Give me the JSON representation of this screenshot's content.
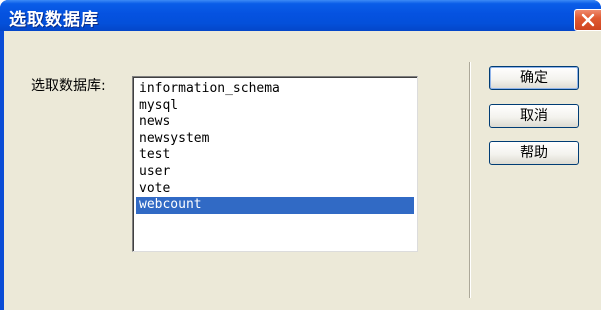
{
  "window": {
    "title": "选取数据库",
    "close_icon": "close-icon"
  },
  "form": {
    "database_label": "选取数据库:",
    "databases": [
      "information_schema",
      "mysql",
      "news",
      "newsystem",
      "test",
      "user",
      "vote",
      "webcount"
    ],
    "selected_database": "webcount"
  },
  "buttons": {
    "ok_label": "确定",
    "cancel_label": "取消",
    "help_label": "帮助"
  },
  "colors": {
    "title_bar": "#0552e0",
    "dialog_face": "#ece9d8",
    "selection": "#316ac5",
    "close_button": "#e05a32"
  }
}
